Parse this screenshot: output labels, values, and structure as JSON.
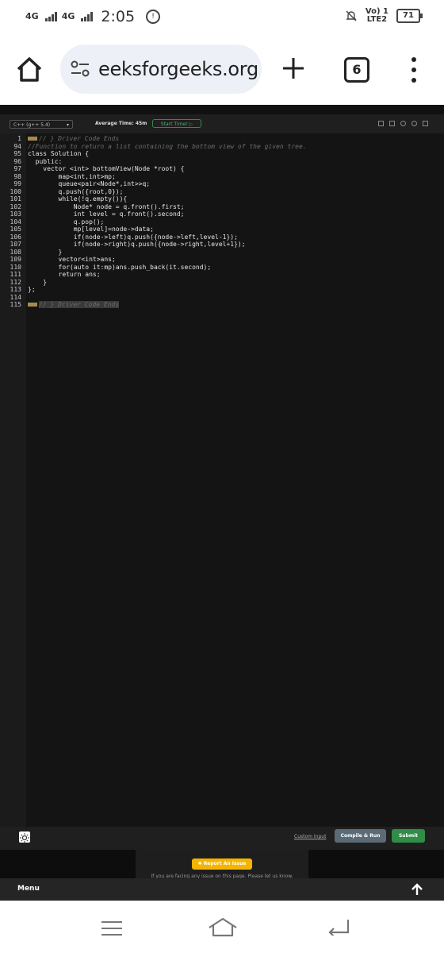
{
  "statusbar": {
    "net1": "4G",
    "net2": "4G",
    "time": "2:05",
    "volte_top": "Vo) 1",
    "volte_bottom": "LTE2",
    "battery": "71"
  },
  "browser": {
    "url": "eeksforgeeks.org",
    "tab_count": "6"
  },
  "editor": {
    "language": "C++ (g++ 5.4)",
    "average_time": "Average Time: 45m",
    "start_timer": "Start Timer",
    "custom_input": "Custom Input",
    "compile_run": "Compile & Run",
    "submit": "Submit",
    "lines": [
      {
        "n": "1",
        "text": "// } Driver Code Ends",
        "type": "foldcomment"
      },
      {
        "n": "94",
        "text": "//Function to return a list containing the bottom view of the given tree.",
        "type": "comment"
      },
      {
        "n": "95",
        "text": "class Solution {",
        "type": "code"
      },
      {
        "n": "96",
        "text": "  public:",
        "type": "code"
      },
      {
        "n": "97",
        "text": "    vector <int> bottomView(Node *root) {",
        "type": "code"
      },
      {
        "n": "98",
        "text": "        map<int,int>mp;",
        "type": "code"
      },
      {
        "n": "99",
        "text": "        queue<pair<Node*,int>>q;",
        "type": "code"
      },
      {
        "n": "100",
        "text": "        q.push({root,0});",
        "type": "code"
      },
      {
        "n": "101",
        "text": "        while(!q.empty()){",
        "type": "code"
      },
      {
        "n": "102",
        "text": "            Node* node = q.front().first;",
        "type": "code"
      },
      {
        "n": "103",
        "text": "            int level = q.front().second;",
        "type": "code"
      },
      {
        "n": "104",
        "text": "            q.pop();",
        "type": "code"
      },
      {
        "n": "105",
        "text": "            mp[level]=node->data;",
        "type": "code"
      },
      {
        "n": "106",
        "text": "            if(node->left)q.push({node->left,level-1});",
        "type": "code"
      },
      {
        "n": "107",
        "text": "            if(node->right)q.push({node->right,level+1});",
        "type": "code"
      },
      {
        "n": "108",
        "text": "        }",
        "type": "code"
      },
      {
        "n": "109",
        "text": "        vector<int>ans;",
        "type": "code"
      },
      {
        "n": "110",
        "text": "        for(auto it:mp)ans.push_back(it.second);",
        "type": "code"
      },
      {
        "n": "111",
        "text": "        return ans;",
        "type": "code"
      },
      {
        "n": "112",
        "text": "    }",
        "type": "code"
      },
      {
        "n": "113",
        "text": "};",
        "type": "code"
      },
      {
        "n": "114",
        "text": "",
        "type": "code"
      },
      {
        "n": "115",
        "text": "// } Driver Code Ends",
        "type": "foldcomment"
      }
    ]
  },
  "page": {
    "report_issue": "Report An Issue",
    "report_note": "If you are facing any issue on this page. Please let us know.",
    "menu": "Menu"
  },
  "colors": {
    "accent_green": "#2f8d46",
    "report_yellow": "#f4b400",
    "editor_bg": "#141414"
  }
}
